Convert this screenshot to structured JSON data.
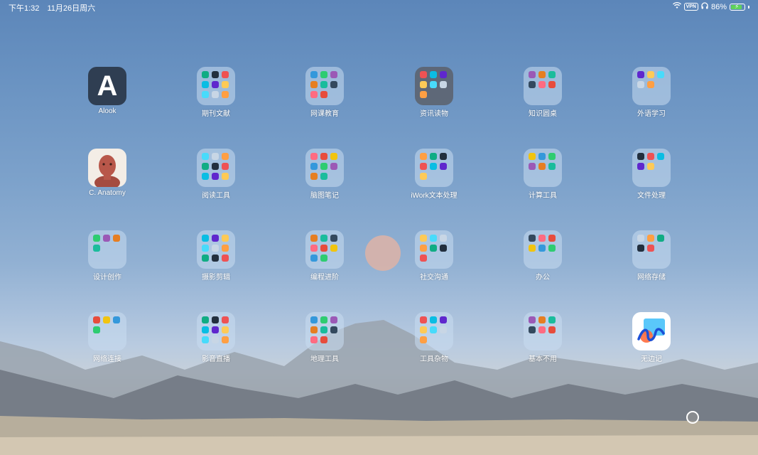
{
  "status_bar": {
    "time": "下午1:32",
    "date": "11月26日周六",
    "vpn": "VPN",
    "battery": "86%",
    "battery_level": 0.86
  },
  "apps": [
    {
      "label": "Alook",
      "kind": "app",
      "icon": "alook-icon",
      "glyph": "A"
    },
    {
      "label": "期刊文献",
      "kind": "folder",
      "icon": "folder-icon"
    },
    {
      "label": "网课教育",
      "kind": "folder",
      "icon": "folder-icon"
    },
    {
      "label": "资讯读物",
      "kind": "folder",
      "icon": "folder-icon"
    },
    {
      "label": "知识圆桌",
      "kind": "folder",
      "icon": "folder-icon"
    },
    {
      "label": "外语学习",
      "kind": "folder",
      "icon": "folder-icon"
    },
    {
      "label": "C. Anatomy",
      "kind": "app",
      "icon": "anatomy-icon"
    },
    {
      "label": "阅读工具",
      "kind": "folder",
      "icon": "folder-icon"
    },
    {
      "label": "脑图笔记",
      "kind": "folder",
      "icon": "folder-icon"
    },
    {
      "label": "iWork文本处理",
      "kind": "folder",
      "icon": "folder-icon"
    },
    {
      "label": "计算工具",
      "kind": "folder",
      "icon": "folder-icon"
    },
    {
      "label": "文件处理",
      "kind": "folder",
      "icon": "folder-icon"
    },
    {
      "label": "设计创作",
      "kind": "folder",
      "icon": "folder-icon"
    },
    {
      "label": "摄影剪辑",
      "kind": "folder",
      "icon": "folder-icon"
    },
    {
      "label": "编程进阶",
      "kind": "folder",
      "icon": "folder-icon"
    },
    {
      "label": "社交沟通",
      "kind": "folder",
      "icon": "folder-icon"
    },
    {
      "label": "办公",
      "kind": "folder",
      "icon": "folder-icon"
    },
    {
      "label": "网络存储",
      "kind": "folder",
      "icon": "folder-icon"
    },
    {
      "label": "网络连接",
      "kind": "folder",
      "icon": "folder-icon"
    },
    {
      "label": "影音直播",
      "kind": "folder",
      "icon": "folder-icon"
    },
    {
      "label": "地理工具",
      "kind": "folder",
      "icon": "folder-icon"
    },
    {
      "label": "工具杂物",
      "kind": "folder",
      "icon": "folder-icon"
    },
    {
      "label": "基本不用",
      "kind": "folder",
      "icon": "folder-icon"
    },
    {
      "label": "无边记",
      "kind": "app",
      "icon": "freeform-icon"
    }
  ],
  "colors": {
    "sky_top": "#5c86b9",
    "sky_mid": "#92b1d3",
    "ground": "#c9c0ae",
    "moon": "#d9b3a8",
    "mountain": "#7a7e86"
  }
}
